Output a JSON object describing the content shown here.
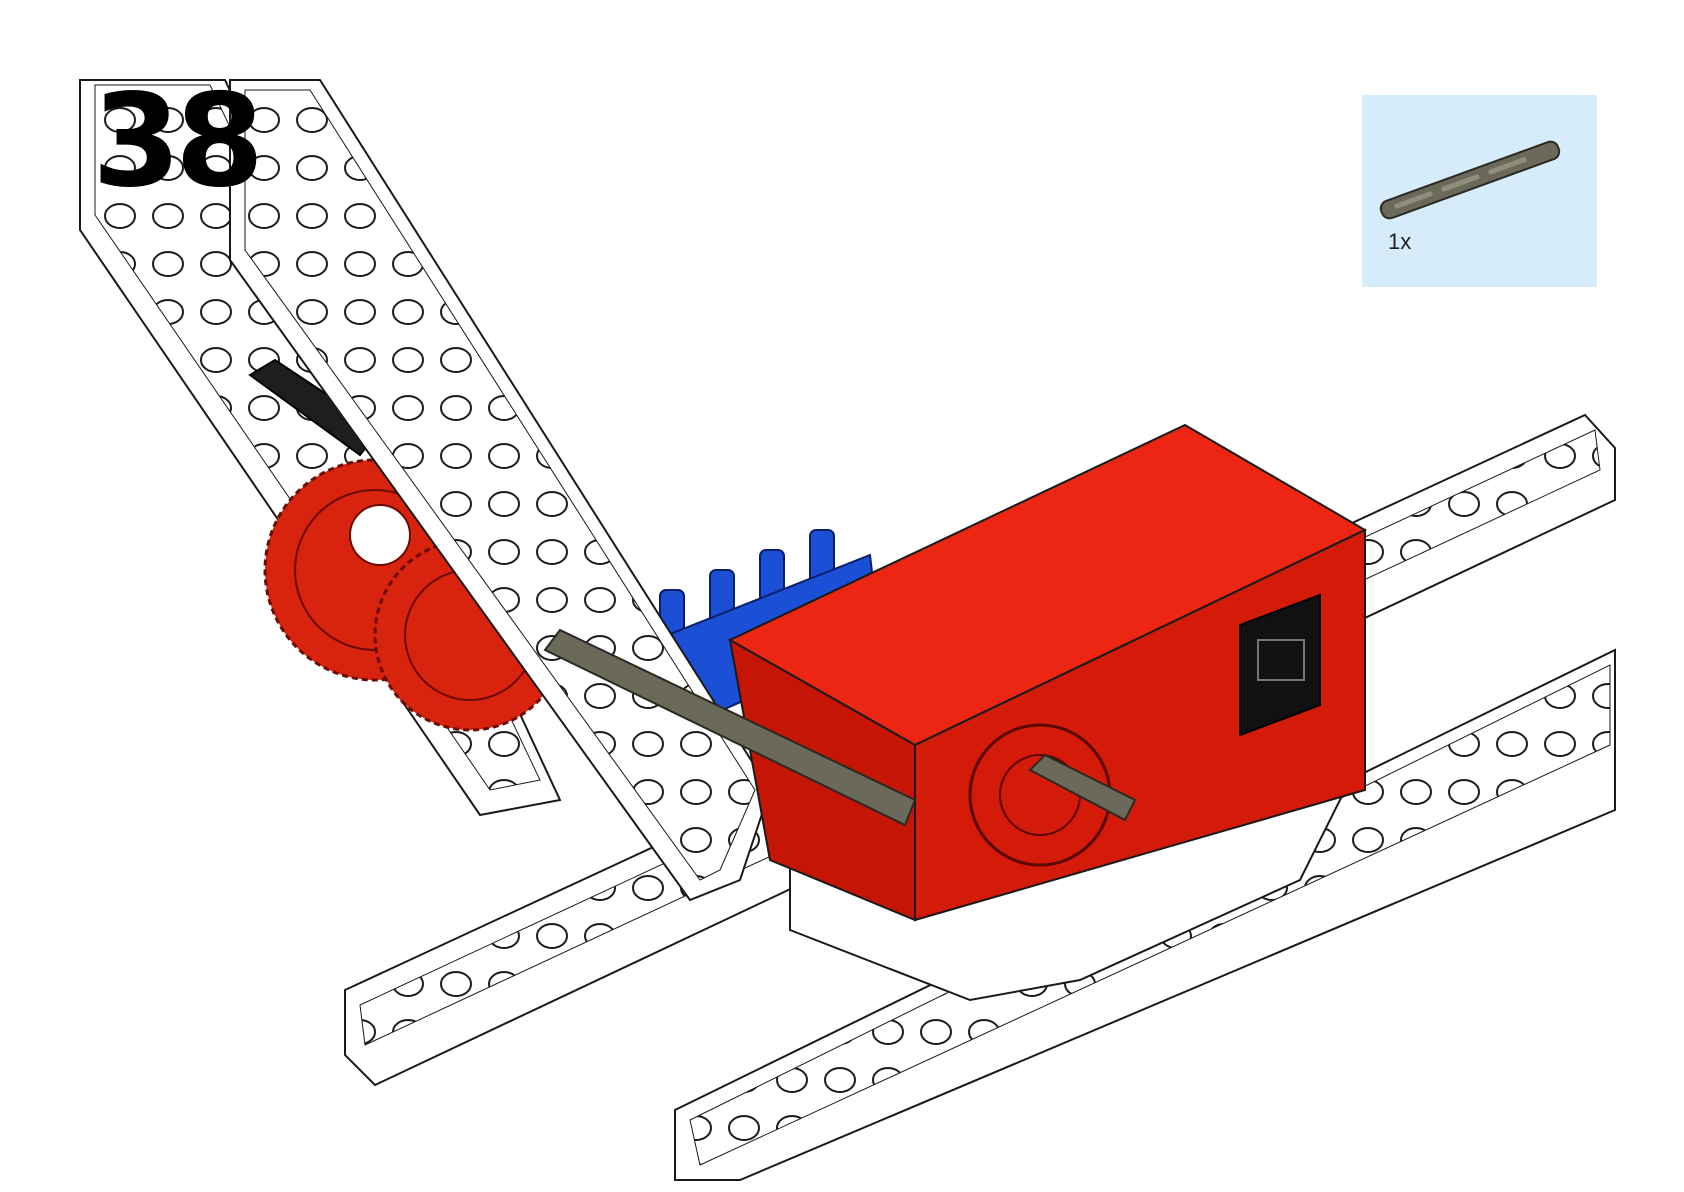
{
  "step": {
    "number": "38"
  },
  "parts_callout": {
    "quantity": "1x",
    "part_icon": "axle-icon",
    "part_color": "#6b6a5a",
    "background_color": "#d6ecfa"
  },
  "scene": {
    "motor_color": "#dd1a0a",
    "gear_color": "#d8230f",
    "connector_pin_color": "#1a4fd6",
    "beam_color": "#ffffff",
    "axle_color": "#6b6a5a",
    "port_color": "#111111"
  }
}
